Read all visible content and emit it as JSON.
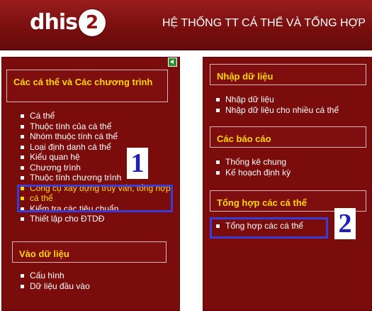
{
  "header": {
    "logo_text": "dhis",
    "logo_number": "2",
    "title": "HỆ THỐNG TT CÁ THỂ VÀ TỔNG HỢP"
  },
  "left_panel": {
    "section1": {
      "title": "Các cá thể và Các chương trình",
      "items": [
        "Cá thể",
        "Thuộc tính của cá thể",
        "Nhóm thuộc tính cá thể",
        "Loại định danh cá thể",
        "Kiểu quan hệ",
        "Chương trình",
        "Thuộc tính chương trình",
        "Công cụ xây dựng truy vấn, tổng hợp",
        "cá thể",
        "Kiểm tra các tiêu chuẩn",
        "Thiết lập cho ĐTDĐ"
      ]
    },
    "section2": {
      "title": "Vào dữ liệu",
      "items": [
        "Cấu hình",
        "Dữ liệu đầu vào"
      ]
    }
  },
  "right_panel": {
    "section1": {
      "title": "Nhập dữ liệu",
      "items": [
        "Nhập dữ liệu",
        "Nhập dữ liệu cho nhiều cá thể"
      ]
    },
    "section2": {
      "title": "Các báo cáo",
      "items": [
        "Thống kê chung",
        "Kế hoạch định kỳ"
      ]
    },
    "section3": {
      "title": "Tổng hợp các cá thể",
      "items": [
        "Tổng hợp các cá thể"
      ]
    }
  },
  "callouts": {
    "first": "1",
    "second": "2"
  },
  "colors": {
    "panel_bg": "#7a0c0c",
    "heading_text": "#ffd800",
    "callout_blue": "#3b3bd6"
  }
}
